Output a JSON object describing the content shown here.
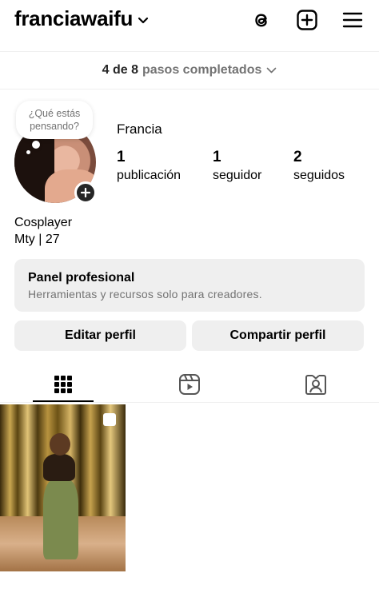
{
  "header": {
    "username": "franciawaifu",
    "icons": [
      "chevron-down-icon",
      "threads-icon",
      "create-post-icon",
      "menu-icon"
    ]
  },
  "steps": {
    "count": "4 de 8",
    "label": "pasos completados"
  },
  "note": {
    "line1": "¿Qué estás",
    "line2": "pensando?"
  },
  "profile": {
    "display_name": "Francia",
    "stats": [
      {
        "value": "1",
        "label": "publicación"
      },
      {
        "value": "1",
        "label": "seguidor"
      },
      {
        "value": "2",
        "label": "seguidos"
      }
    ],
    "bio_line1": "Cosplayer",
    "bio_line2": "Mty | 27"
  },
  "panel": {
    "title": "Panel profesional",
    "subtitle": "Herramientas y recursos solo para creadores."
  },
  "buttons": {
    "edit": "Editar perfil",
    "share": "Compartir perfil"
  },
  "tabs": [
    {
      "icon": "grid-icon",
      "active": true
    },
    {
      "icon": "reels-icon",
      "active": false
    },
    {
      "icon": "tagged-icon",
      "active": false
    }
  ],
  "colors": {
    "secondary_text": "#737373",
    "button_bg": "#efefef",
    "divider": "#efefef"
  }
}
